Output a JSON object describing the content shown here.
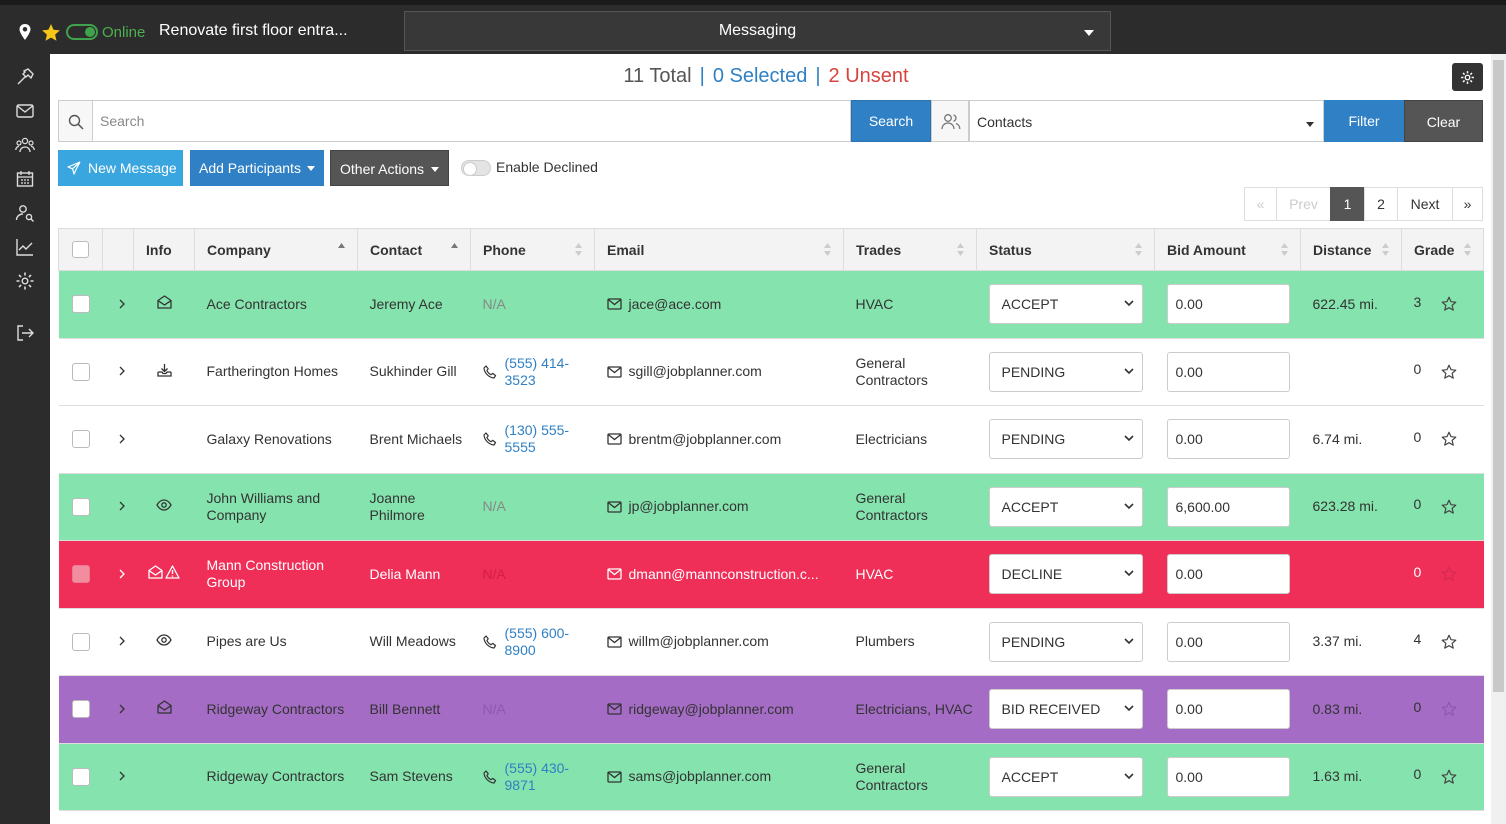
{
  "topbar": {
    "status": "Online",
    "project": "Renovate first floor entra...",
    "module": "Messaging"
  },
  "sidebar": {
    "icons": [
      "hammer-icon",
      "envelope-icon",
      "users-icon",
      "calendar-icon",
      "user-search-icon",
      "chart-icon",
      "gear-icon",
      "sign-out-icon"
    ]
  },
  "summary": {
    "total": "11 Total",
    "sep1": "|",
    "selected": "0 Selected",
    "sep2": "|",
    "unsent": "2 Unsent"
  },
  "search": {
    "placeholder": "Search",
    "button": "Search",
    "filter_value": "Contacts",
    "filter_button": "Filter",
    "clear_button": "Clear"
  },
  "actions": {
    "new_message": "New Message",
    "add_participants": "Add Participants",
    "other_actions": "Other Actions",
    "enable_declined": "Enable Declined"
  },
  "pager": {
    "first": "«",
    "prev": "Prev",
    "page1": "1",
    "page2": "2",
    "next": "Next",
    "last": "»"
  },
  "columns": {
    "info": "Info",
    "company": "Company",
    "contact": "Contact",
    "phone": "Phone",
    "email": "Email",
    "trades": "Trades",
    "status": "Status",
    "bid": "Bid Amount",
    "distance": "Distance",
    "grade": "Grade"
  },
  "rows": [
    {
      "company": "Ace Contractors",
      "contact": "Jeremy Ace",
      "phone": "N/A",
      "email": "jace@ace.com",
      "trades": "HVAC",
      "status": "ACCEPT",
      "bid": "0.00",
      "distance": "622.45 mi.",
      "grade": "3"
    },
    {
      "company": "Fartherington Homes",
      "contact": "Sukhinder Gill",
      "phone": "(555) 414-3523",
      "email": "sgill@jobplanner.com",
      "trades": "General Contractors",
      "status": "PENDING",
      "bid": "0.00",
      "distance": "",
      "grade": "0"
    },
    {
      "company": "Galaxy Renovations",
      "contact": "Brent Michaels",
      "phone": "(130) 555-5555",
      "email": "brentm@jobplanner.com",
      "trades": "Electricians",
      "status": "PENDING",
      "bid": "0.00",
      "distance": "6.74 mi.",
      "grade": "0"
    },
    {
      "company": "John Williams and Company",
      "contact": "Joanne Philmore",
      "phone": "N/A",
      "email": "jp@jobplanner.com",
      "trades": "General Contractors",
      "status": "ACCEPT",
      "bid": "6,600.00",
      "distance": "623.28 mi.",
      "grade": "0"
    },
    {
      "company": "Mann Construction Group",
      "contact": "Delia Mann",
      "phone": "N/A",
      "email": "dmann@mannconstruction.c...",
      "trades": "HVAC",
      "status": "DECLINE",
      "bid": "0.00",
      "distance": "",
      "grade": "0"
    },
    {
      "company": "Pipes are Us",
      "contact": "Will Meadows",
      "phone": "(555) 600-8900",
      "email": "willm@jobplanner.com",
      "trades": "Plumbers",
      "status": "PENDING",
      "bid": "0.00",
      "distance": "3.37 mi.",
      "grade": "4"
    },
    {
      "company": "Ridgeway Contractors",
      "contact": "Bill Bennett",
      "phone": "N/A",
      "email": "ridgeway@jobplanner.com",
      "trades": "Electricians, HVAC",
      "status": "BID RECEIVED",
      "bid": "0.00",
      "distance": "0.83 mi.",
      "grade": "0"
    },
    {
      "company": "Ridgeway Contractors",
      "contact": "Sam Stevens",
      "phone": "(555) 430-9871",
      "email": "sams@jobplanner.com",
      "trades": "General Contractors",
      "status": "ACCEPT",
      "bid": "0.00",
      "distance": "1.63 mi.",
      "grade": "0"
    }
  ],
  "colors": {
    "accept": "#85e3ad",
    "decline": "#ef2f58",
    "bid_received": "#a46cc4",
    "primary": "#2f80c4"
  }
}
